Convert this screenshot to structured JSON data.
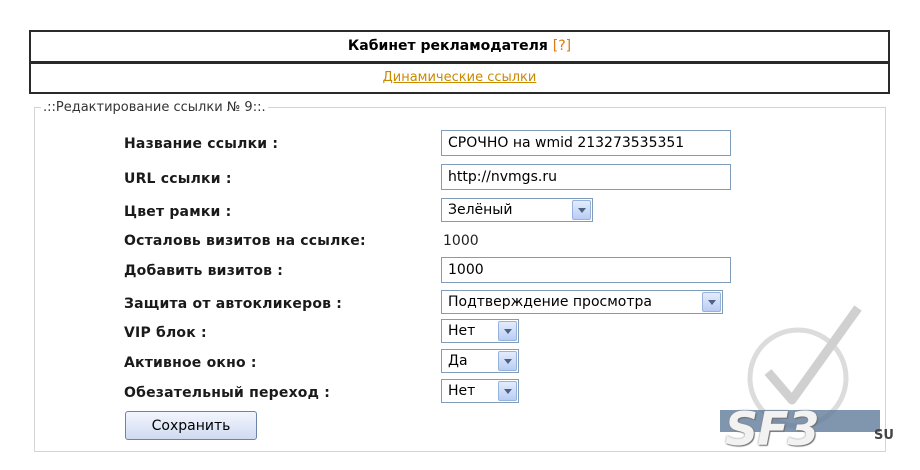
{
  "header": {
    "title": "Кабинет рекламодателя",
    "help": "[?]"
  },
  "nav": {
    "link": "Динамические ссылки"
  },
  "form": {
    "legend": ".::Редактирование ссылки № 9::.",
    "name_label": "Название ссылки :",
    "name_value": "СРОЧНО на wmid 213273535351",
    "url_label": "URL ссылки :",
    "url_value": "http://nvmgs.ru",
    "frame_color_label": "Цвет рамки :",
    "frame_color_value": "Зелёный",
    "visits_left_label": "Осталовь визитов на ссылке:",
    "visits_left_value": "1000",
    "add_visits_label": "Добавить визитов :",
    "add_visits_value": "1000",
    "protection_label": "Защита от автокликеров :",
    "protection_value": "Подтверждение просмотра",
    "vip_label": "VIP блок :",
    "vip_value": "Нет",
    "active_window_label": "Активное окно :",
    "active_window_value": "Да",
    "required_click_label": "Обезательный переход :",
    "required_click_value": "Нет",
    "save_label": "Сохранить"
  },
  "watermark": {
    "text": "SF3",
    "suffix": "SU"
  }
}
